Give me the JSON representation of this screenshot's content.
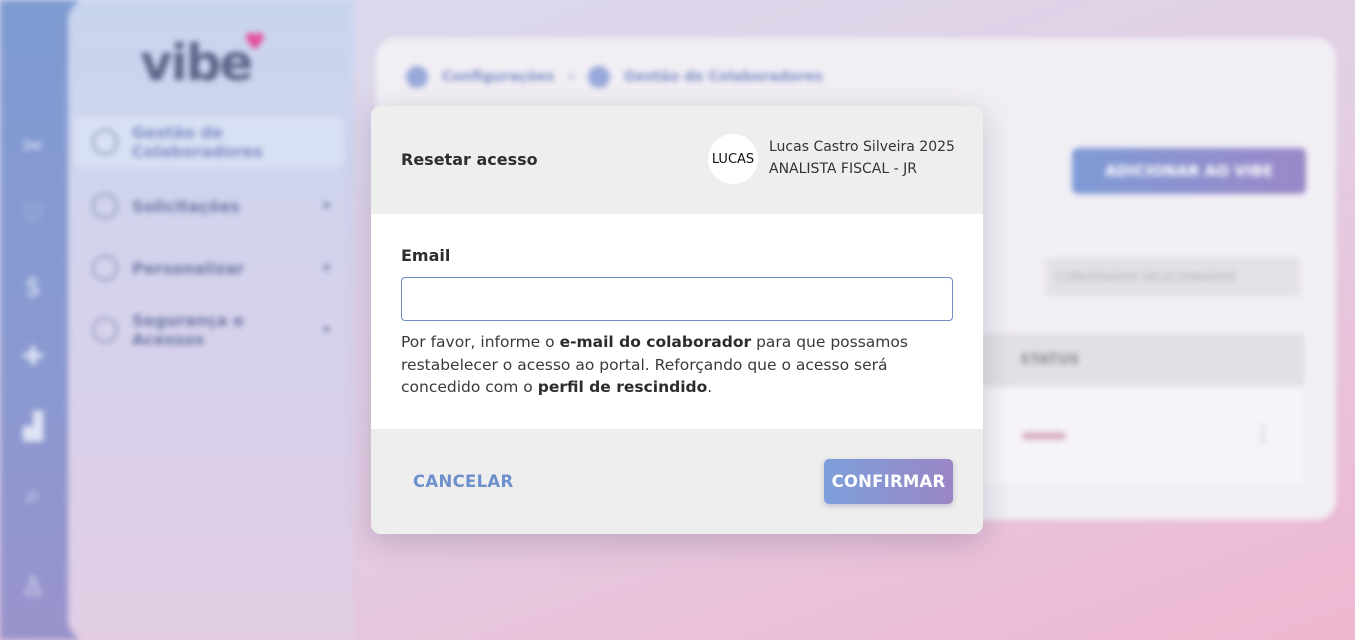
{
  "background": {
    "logo_text": "vibe",
    "sidebar_items": [
      {
        "label": "Gestão de Colaboradores",
        "active": true
      },
      {
        "label": "Solicitações"
      },
      {
        "label": "Personalizar"
      },
      {
        "label": "Segurança e Acessos"
      }
    ],
    "breadcrumb": [
      "Configurações",
      "Gestão de Colaboradores"
    ],
    "add_button": "ADICIONAR AO VIBE",
    "tab_strip_text": "CONVIDADOS SELECIONADOS",
    "table_header": "STATUS"
  },
  "modal": {
    "title": "Resetar acesso",
    "user": {
      "avatar_text": "LUCAS",
      "name": "Lucas Castro Silveira 2025",
      "role": "ANALISTA FISCAL - JR"
    },
    "email_label": "Email",
    "email_value": "",
    "email_placeholder": "",
    "help": {
      "p1": "Por favor, informe o ",
      "b1": "e-mail do colaborador",
      "p2": " para que possamos restabelecer o acesso ao portal. Reforçando que o acesso será concedido com o ",
      "b2": "perfil de rescindido",
      "p3": "."
    },
    "cancel_label": "CANCELAR",
    "confirm_label": "CONFIRMAR"
  },
  "colors": {
    "accent_blue": "#6d8fcb",
    "accent_purple": "#9a86c4",
    "header_bg": "#eeeeee"
  }
}
